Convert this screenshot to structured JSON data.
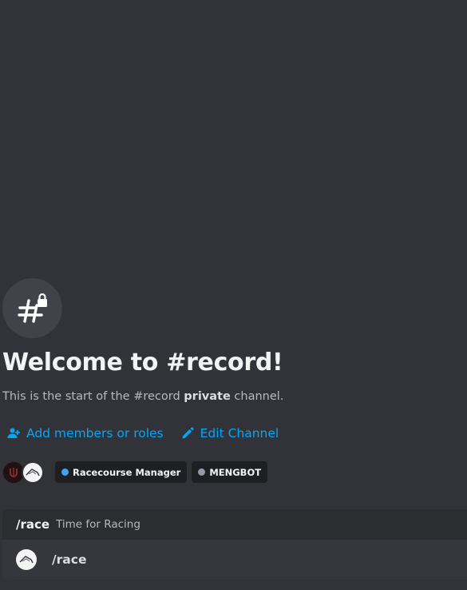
{
  "channel": {
    "icon": "hashtag-lock-icon",
    "welcome_title": "Welcome to #record!",
    "desc_prefix": "This is the start of the #record ",
    "desc_bold": "private",
    "desc_suffix": " channel."
  },
  "actions": [
    {
      "label": "Add members or roles",
      "icon": "add-person-icon"
    },
    {
      "label": "Edit Channel",
      "icon": "pencil-icon"
    }
  ],
  "members": {
    "avatars": [
      "member-avatar-dark",
      "member-avatar-bot"
    ],
    "roles": [
      {
        "label": "Racecourse Manager",
        "color": "#3ba5f2"
      },
      {
        "label": "MENGBOT",
        "color": "#949ba4"
      }
    ]
  },
  "command": {
    "name": "/race",
    "description": "Time for Racing",
    "option_label": "/race"
  },
  "colors": {
    "background": "#313338",
    "link": "#00a8fc",
    "card": "#2b2d31",
    "card_row": "#35373c"
  }
}
